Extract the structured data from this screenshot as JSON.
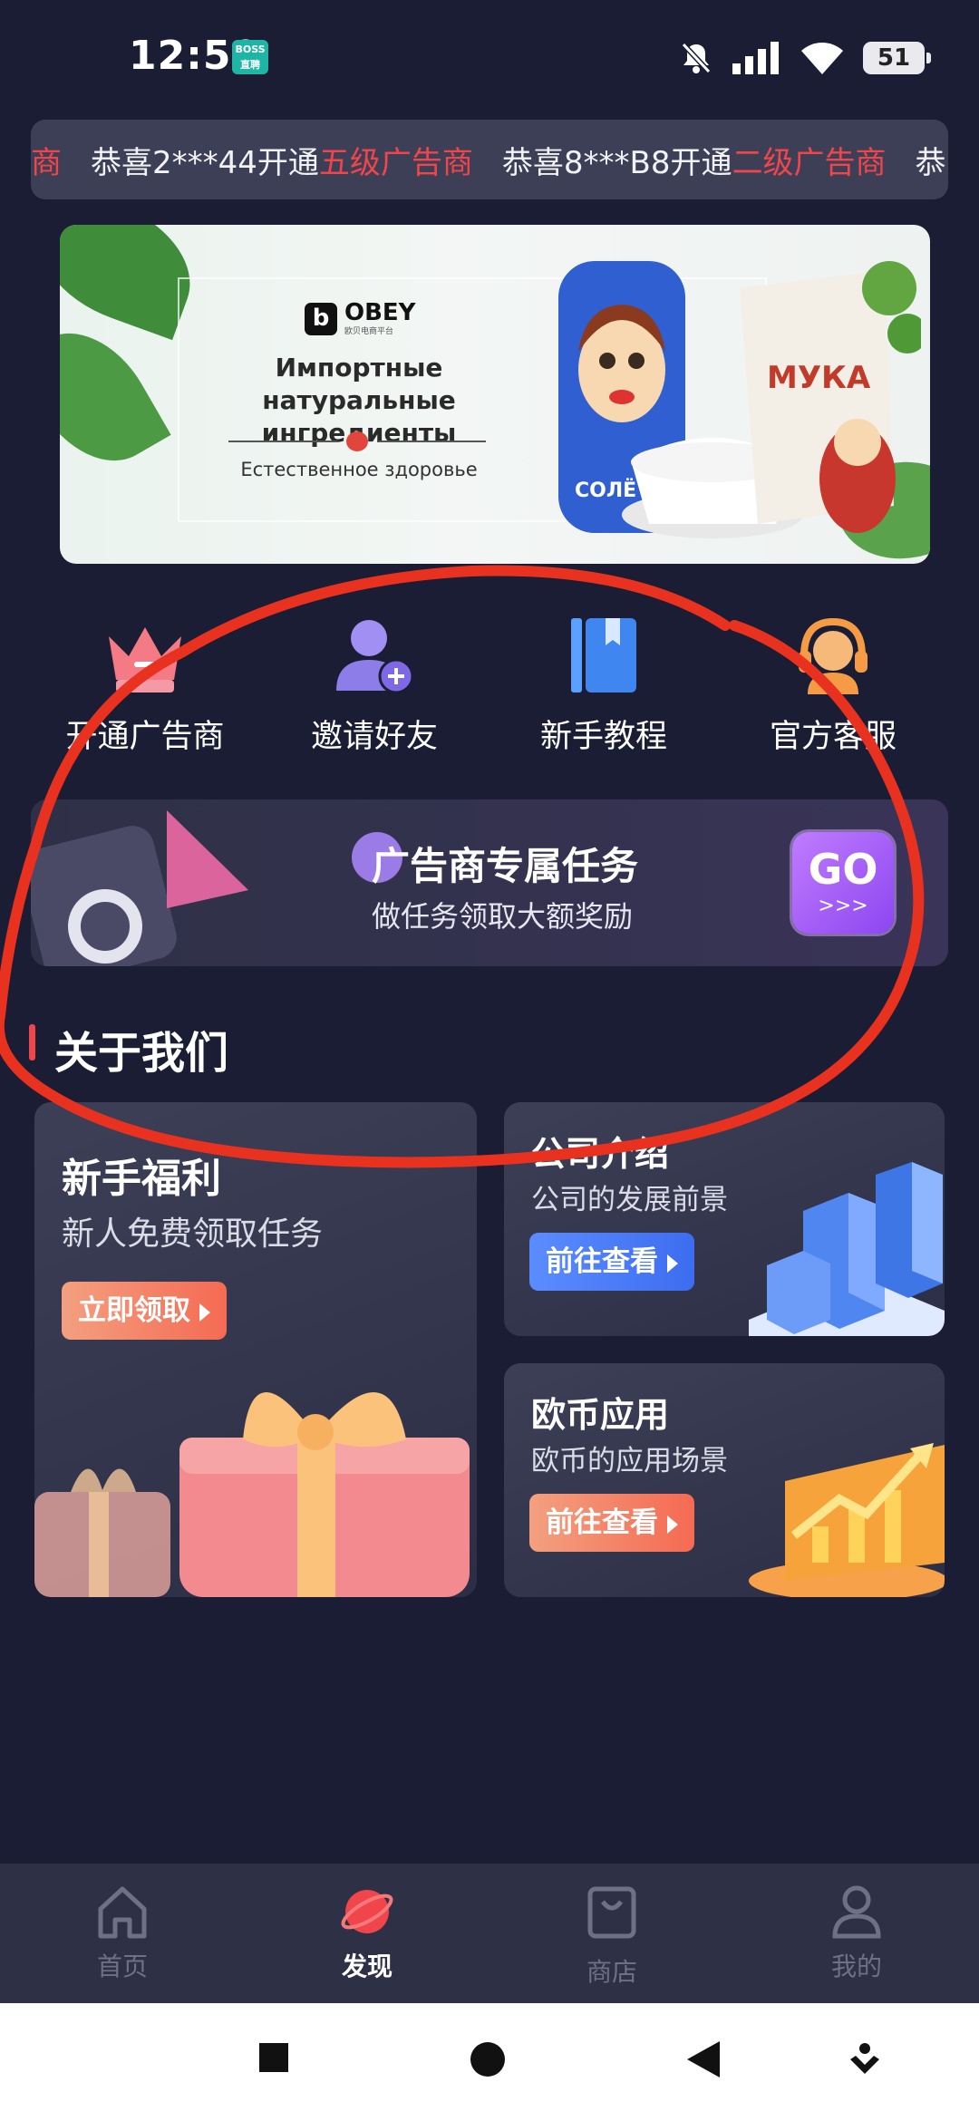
{
  "status_bar": {
    "time": "12:50",
    "app_badge": "BOSS直聘",
    "battery": "51",
    "icons": [
      "mute-icon",
      "signal-icon",
      "wifi-icon",
      "battery-icon"
    ]
  },
  "marquee": {
    "items": [
      {
        "text": "",
        "highlight": "商"
      },
      {
        "text": "恭喜2***44开通",
        "highlight": "五级广告商"
      },
      {
        "text": "恭喜8***B8开通",
        "highlight": "二级广告商"
      },
      {
        "text": "恭",
        "highlight": ""
      }
    ]
  },
  "banner": {
    "brand": "OBEY",
    "brand_sub": "欧贝电商平台",
    "headline": "Импортные натуральные ингредиенты",
    "subline": "Естественное здоровье",
    "product_labels": [
      "МУКА",
      "СОЛЁ"
    ]
  },
  "actions": [
    {
      "label": "开通广告商",
      "icon": "crown-icon",
      "color": "#f47a86"
    },
    {
      "label": "邀请好友",
      "icon": "add-user-icon",
      "color": "#9a8df2"
    },
    {
      "label": "新手教程",
      "icon": "book-icon",
      "color": "#4f8ff2"
    },
    {
      "label": "官方客服",
      "icon": "headset-icon",
      "color": "#f59b45"
    }
  ],
  "task_banner": {
    "title": "广告商专属任务",
    "subtitle": "做任务领取大额奖励",
    "go": "GO",
    "go_arrows": ">>>"
  },
  "about": {
    "section_title": "关于我们",
    "cards": [
      {
        "title": "新手福利",
        "desc": "新人免费领取任务",
        "button": "立即领取",
        "illustration": "gift-box-icon"
      },
      {
        "title": "公司介绍",
        "desc": "公司的发展前景",
        "button": "前往查看",
        "illustration": "city-buildings-icon"
      },
      {
        "title": "欧币应用",
        "desc": "欧币的应用场景",
        "button": "前往查看",
        "illustration": "growth-chart-icon"
      }
    ]
  },
  "bottom_nav": {
    "items": [
      {
        "label": "首页",
        "icon": "home-icon",
        "active": false
      },
      {
        "label": "发现",
        "icon": "planet-icon",
        "active": true
      },
      {
        "label": "商店",
        "icon": "shopping-bag-icon",
        "active": false
      },
      {
        "label": "我的",
        "icon": "profile-icon",
        "active": false
      }
    ]
  },
  "colors": {
    "background": "#1a1d33",
    "accent_red": "#f0454a",
    "annotation": "#e8321f",
    "go_purple": "#a05ff5"
  }
}
